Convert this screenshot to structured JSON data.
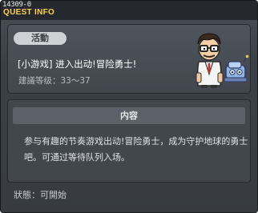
{
  "window": {
    "id": "14309-0",
    "title": "QUEST INFO"
  },
  "quest": {
    "badge": "活動",
    "name": "[小游戏] 进入出动!冒险勇士!",
    "level_label": "建議等级：33～37",
    "npc_icon": "scientist-npc-icon"
  },
  "content": {
    "header": "内容",
    "description": "参与有趣的节奏游戏出动!冒险勇士，成为守护地球的勇士吧。可通过等待队列入场。"
  },
  "status": {
    "text": "狀態：可開始"
  },
  "colors": {
    "title": "#ffd34a",
    "window_bg": "#3b4047",
    "panel_bg": "#42474e"
  }
}
